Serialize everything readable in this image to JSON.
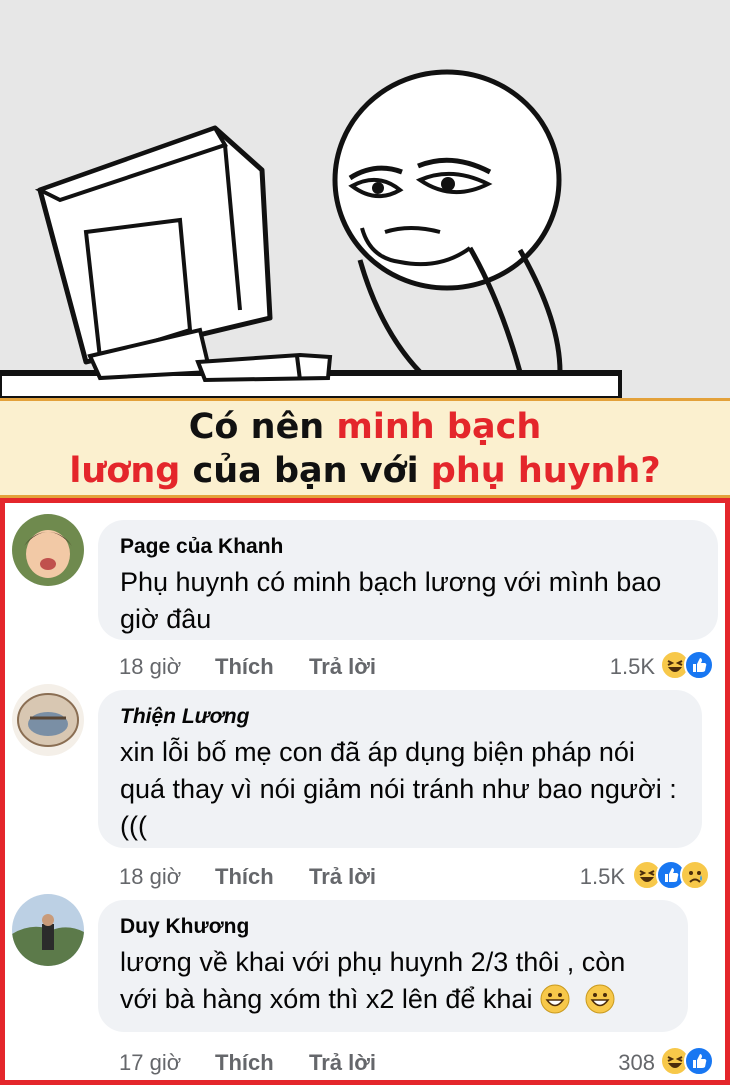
{
  "banner": {
    "part1": "Có nên ",
    "part2": "minh bạch",
    "part3": "lương",
    "part4": " của bạn với ",
    "part5": "phụ huynh?",
    "accent_color": "#e4262b",
    "background_color": "#fbf0cf"
  },
  "comments": [
    {
      "name": "Page của Khanh",
      "text": "Phụ huynh có minh bạch lương với mình bao giờ đâu",
      "time": "18 giờ",
      "like_label": "Thích",
      "reply_label": "Trả lời",
      "reaction_count": "1.5K",
      "reactions": [
        "haha-icon",
        "like-icon"
      ]
    },
    {
      "name": "Thiện Lương",
      "text": "xin lỗi bố mẹ con đã áp dụng biện pháp nói quá thay vì nói giảm nói tránh như bao người :(((",
      "time": "18 giờ",
      "like_label": "Thích",
      "reply_label": "Trả lời",
      "reaction_count": "1.5K",
      "reactions": [
        "haha-icon",
        "like-icon",
        "sad-icon"
      ]
    },
    {
      "name": "Duy Khương",
      "text": "lương về khai với phụ huynh 2/3 thôi , còn với bà hàng xóm thì x2 lên để khai",
      "time": "17 giờ",
      "like_label": "Thích",
      "reply_label": "Trả lời",
      "reaction_count": "308",
      "reactions": [
        "haha-icon",
        "like-icon"
      ]
    }
  ],
  "frame_color": "#e4262b",
  "bubble_color": "#f0f2f5"
}
